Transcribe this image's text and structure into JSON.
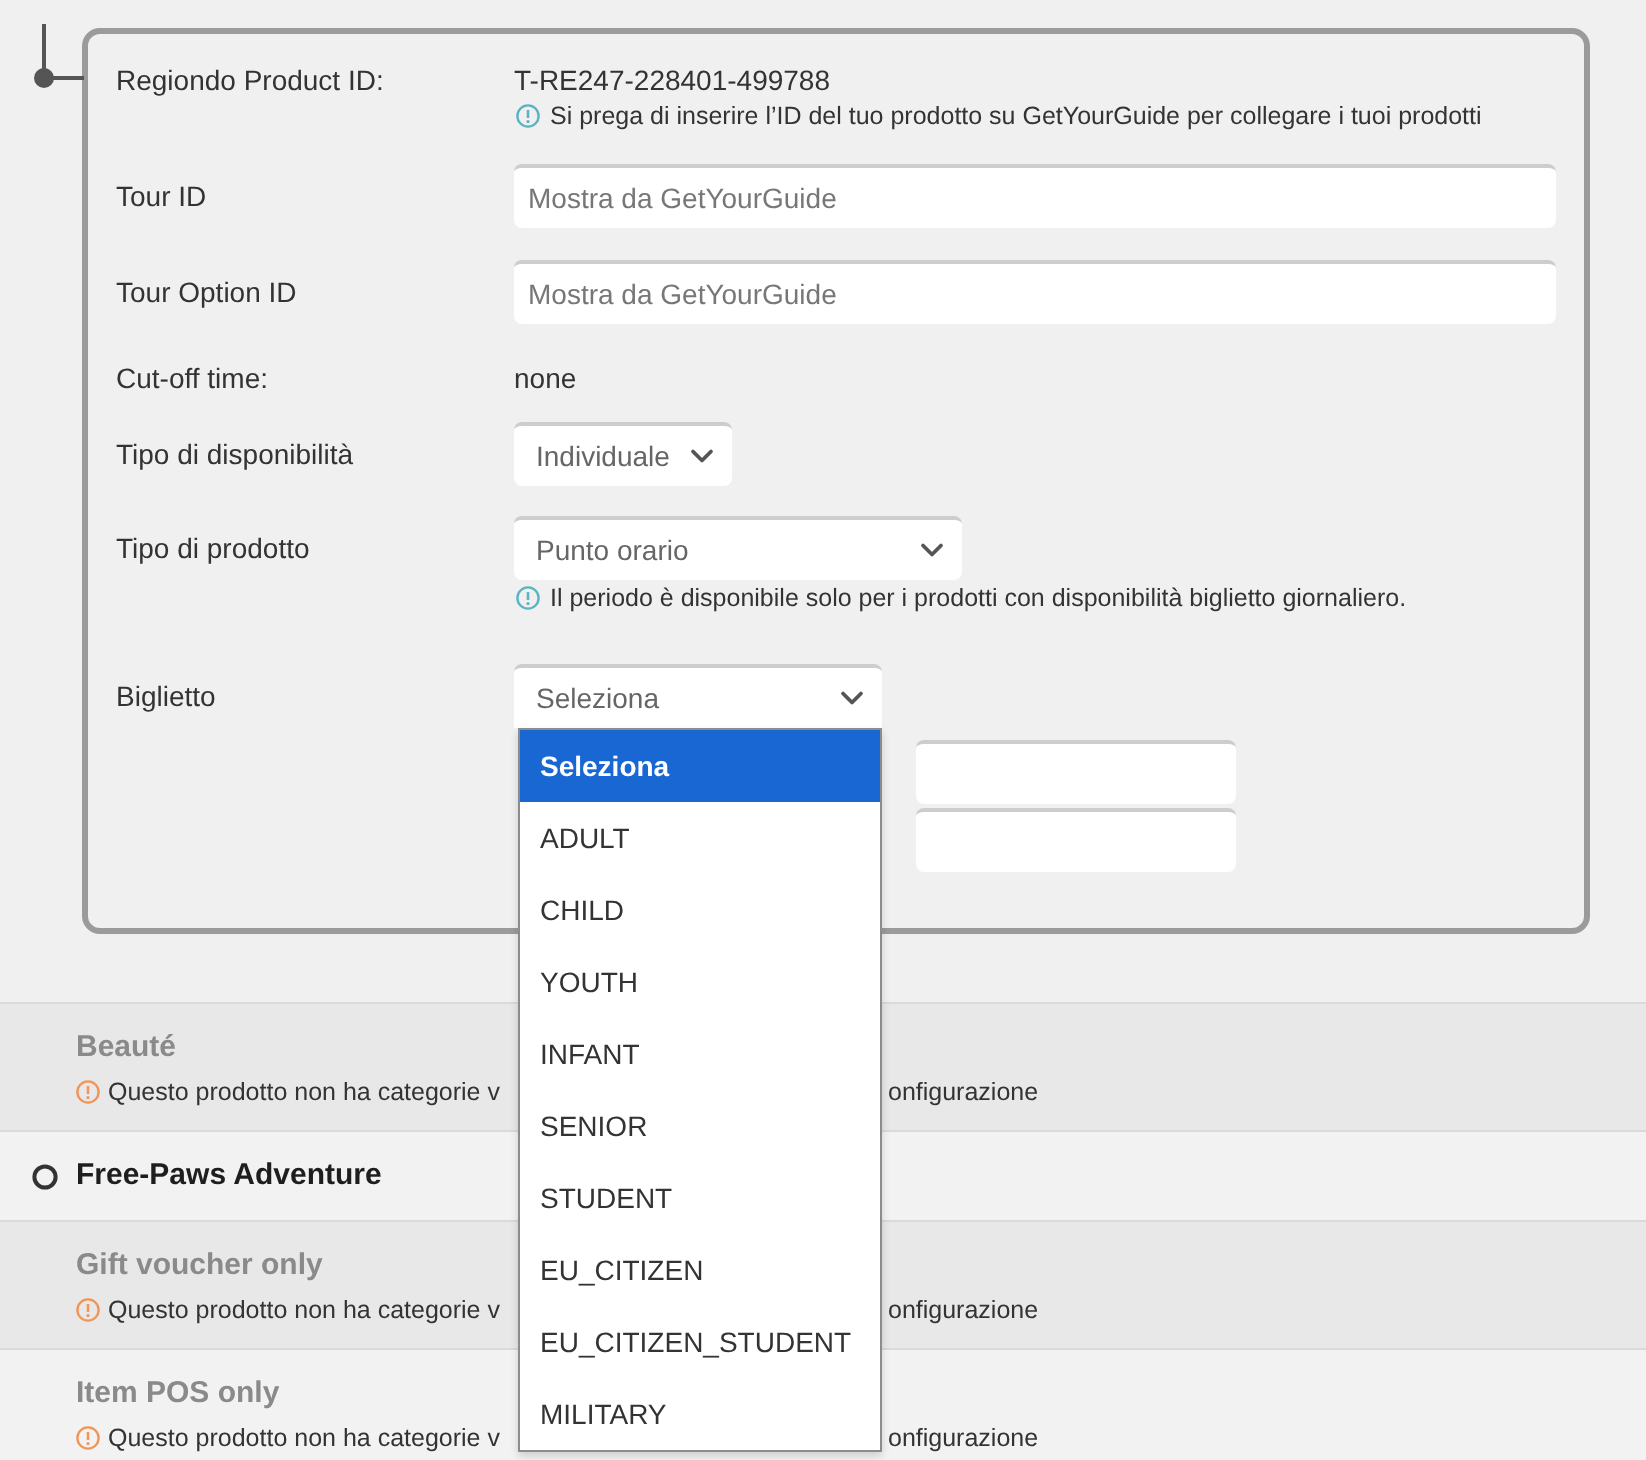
{
  "product_form": {
    "fields": [
      {
        "kind": "text",
        "label": "Regiondo Product ID:",
        "value": "T-RE247-228401-499788",
        "hint": "Si prega di inserire l’ID del tuo prodotto su GetYourGuide per collegare i tuoi prodotti"
      },
      {
        "kind": "input",
        "label": "Tour ID",
        "placeholder": "Mostra da GetYourGuide"
      },
      {
        "kind": "input",
        "label": "Tour Option ID",
        "placeholder": "Mostra da GetYourGuide"
      },
      {
        "kind": "text",
        "label": "Cut-off time:",
        "value": "none"
      },
      {
        "kind": "select",
        "label": "Tipo di disponibilità",
        "value": "Individuale",
        "expanded": false
      },
      {
        "kind": "select",
        "label": "Tipo di prodotto",
        "value": "Punto orario",
        "expanded": false,
        "hint": "Il periodo è disponibile solo per i prodotti con disponibilità biglietto giornaliero."
      },
      {
        "kind": "select",
        "label": "Biglietto",
        "value": "Seleziona",
        "expanded": true,
        "options": [
          {
            "label": "Seleziona",
            "selected": true
          },
          {
            "label": "ADULT",
            "selected": false
          },
          {
            "label": "CHILD",
            "selected": false
          },
          {
            "label": "YOUTH",
            "selected": false
          },
          {
            "label": "INFANT",
            "selected": false
          },
          {
            "label": "SENIOR",
            "selected": false
          },
          {
            "label": "STUDENT",
            "selected": false
          },
          {
            "label": "EU_CITIZEN",
            "selected": false
          },
          {
            "label": "EU_CITIZEN_STUDENT",
            "selected": false
          },
          {
            "label": "MILITARY",
            "selected": false
          }
        ],
        "extra_inputs": [
          {
            "kind": "input"
          },
          {
            "kind": "input"
          }
        ]
      }
    ]
  },
  "products": [
    {
      "name": "Beauté",
      "disabled": true,
      "warning": [
        "Questo prodotto non ha categorie v",
        "onfigurazione"
      ]
    },
    {
      "name": "Free-Paws Adventure",
      "disabled": false
    },
    {
      "name": "Gift voucher only",
      "disabled": true,
      "warning": [
        "Questo prodotto non ha categorie v",
        "onfigurazione"
      ]
    },
    {
      "name": "Item POS only",
      "disabled": true,
      "warning": [
        "Questo prodotto non ha categorie v",
        "onfigurazione"
      ]
    }
  ]
}
